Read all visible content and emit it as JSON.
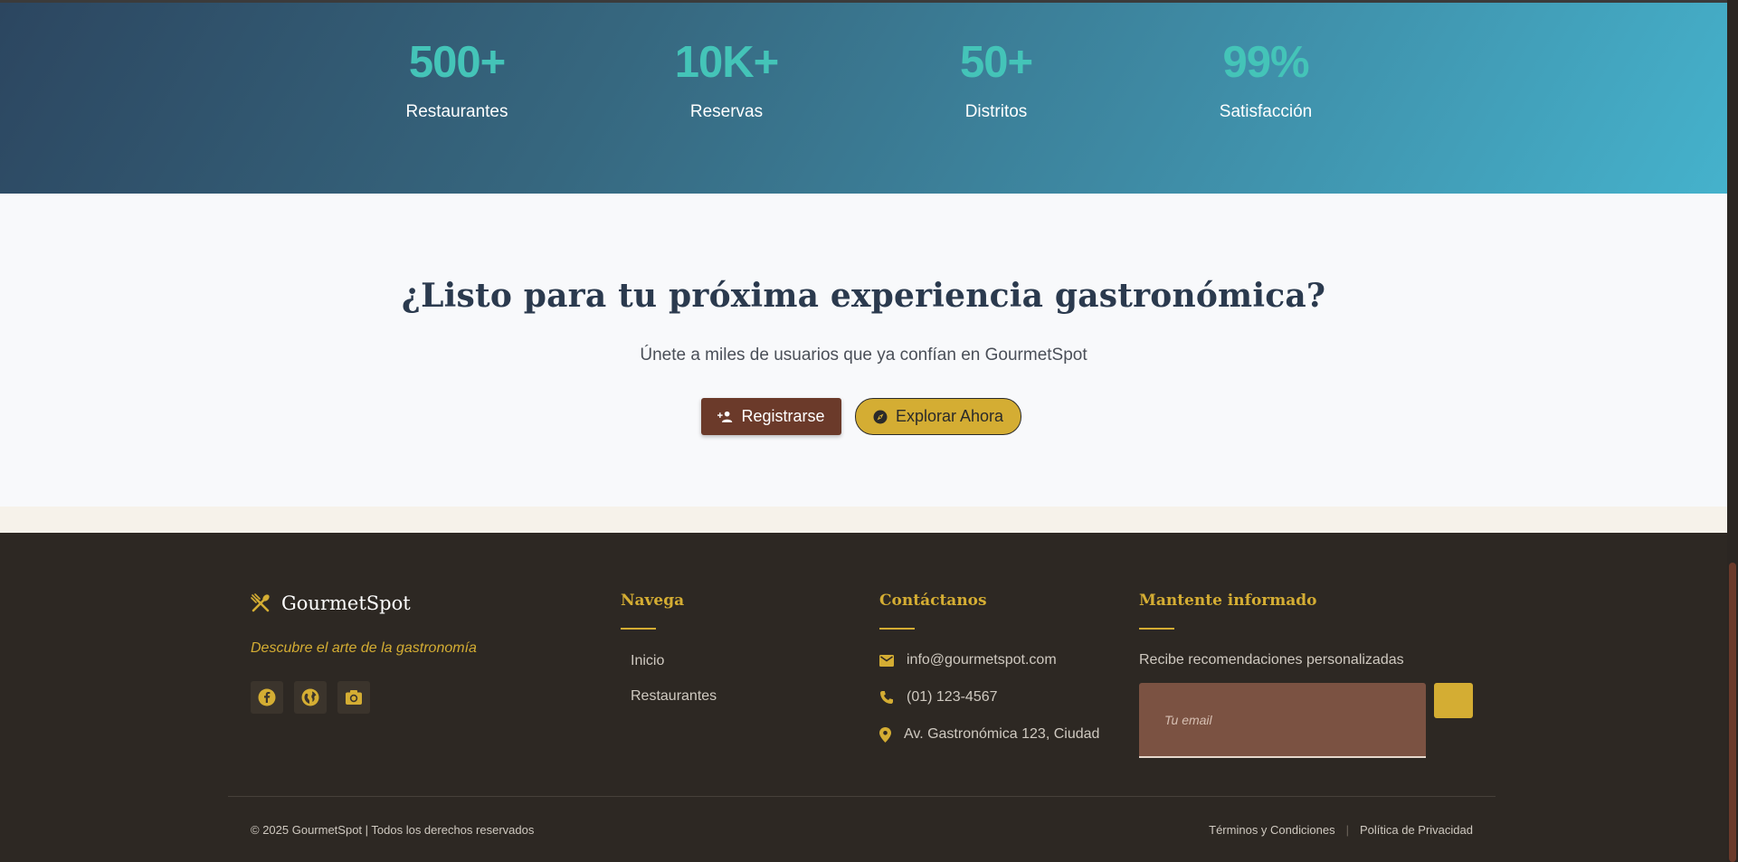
{
  "stats": [
    {
      "value": "500+",
      "label": "Restaurantes"
    },
    {
      "value": "10K+",
      "label": "Reservas"
    },
    {
      "value": "50+",
      "label": "Distritos"
    },
    {
      "value": "99%",
      "label": "Satisfacción"
    }
  ],
  "cta": {
    "title": "¿Listo para tu próxima experiencia gastronómica?",
    "subtitle": "Únete a miles de usuarios que ya confían en GourmetSpot",
    "register_label": "Registrarse",
    "explore_label": "Explorar Ahora"
  },
  "footer": {
    "brand": "GourmetSpot",
    "tagline": "Descubre el arte de la gastronomía",
    "socials": [
      "facebook-icon",
      "globe-icon",
      "camera-icon"
    ],
    "nav": {
      "heading": "Navega",
      "links": [
        "Inicio",
        "Restaurantes"
      ]
    },
    "contact": {
      "heading": "Contáctanos",
      "email": "info@gourmetspot.com",
      "phone": "(01) 123-4567",
      "address": "Av. Gastronómica 123, Ciudad"
    },
    "newsletter": {
      "heading": "Mantente informado",
      "description": "Recibe recomendaciones personalizadas",
      "placeholder": "Tu email"
    },
    "copyright": "© 2025 GourmetSpot | Todos los derechos reservados",
    "legal": {
      "terms": "Términos y Condiciones",
      "separator": "|",
      "privacy": "Política de Privacidad"
    }
  },
  "colors": {
    "accent": "#d4ad33",
    "stat_value": "#44c4b8",
    "brown": "#6b3a2a",
    "footer_bg": "#2d2823"
  }
}
